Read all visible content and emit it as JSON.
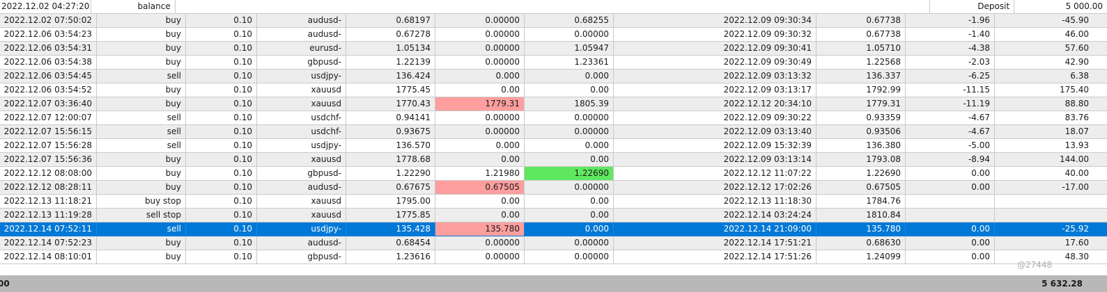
{
  "balance_row": {
    "time": "2022.12.02 04:27:20",
    "type": "balance",
    "comment": "Deposit",
    "profit": "5 000.00"
  },
  "rows": [
    [
      "2022.12.02 07:50:02",
      "buy",
      "0.10",
      "audusd-",
      "0.68197",
      "0.00000",
      "0.68255",
      "2022.12.09 09:30:34",
      "0.67738",
      "-1.96",
      "-45.90"
    ],
    [
      "2022.12.06 03:54:23",
      "buy",
      "0.10",
      "audusd-",
      "0.67278",
      "0.00000",
      "0.00000",
      "2022.12.09 09:30:32",
      "0.67738",
      "-1.40",
      "46.00"
    ],
    [
      "2022.12.06 03:54:31",
      "buy",
      "0.10",
      "eurusd-",
      "1.05134",
      "0.00000",
      "1.05947",
      "2022.12.09 09:30:41",
      "1.05710",
      "-4.38",
      "57.60"
    ],
    [
      "2022.12.06 03:54:38",
      "buy",
      "0.10",
      "gbpusd-",
      "1.22139",
      "0.00000",
      "1.23361",
      "2022.12.09 09:30:49",
      "1.22568",
      "-2.03",
      "42.90"
    ],
    [
      "2022.12.06 03:54:45",
      "sell",
      "0.10",
      "usdjpy-",
      "136.424",
      "0.000",
      "0.000",
      "2022.12.09 03:13:32",
      "136.337",
      "-6.25",
      "6.38"
    ],
    [
      "2022.12.06 03:54:52",
      "buy",
      "0.10",
      "xauusd",
      "1775.45",
      "0.00",
      "0.00",
      "2022.12.09 03:13:17",
      "1792.99",
      "-11.15",
      "175.40"
    ],
    [
      "2022.12.07 03:36:40",
      "buy",
      "0.10",
      "xauusd",
      "1770.43",
      "1779.31",
      "1805.39",
      "2022.12.12 20:34:10",
      "1779.31",
      "-11.19",
      "88.80"
    ],
    [
      "2022.12.07 12:00:07",
      "sell",
      "0.10",
      "usdchf-",
      "0.94141",
      "0.00000",
      "0.00000",
      "2022.12.09 09:30:22",
      "0.93359",
      "-4.67",
      "83.76"
    ],
    [
      "2022.12.07 15:56:15",
      "sell",
      "0.10",
      "usdchf-",
      "0.93675",
      "0.00000",
      "0.00000",
      "2022.12.09 03:13:40",
      "0.93506",
      "-4.67",
      "18.07"
    ],
    [
      "2022.12.07 15:56:28",
      "sell",
      "0.10",
      "usdjpy-",
      "136.570",
      "0.000",
      "0.000",
      "2022.12.09 15:32:39",
      "136.380",
      "-5.00",
      "13.93"
    ],
    [
      "2022.12.07 15:56:36",
      "buy",
      "0.10",
      "xauusd",
      "1778.68",
      "0.00",
      "0.00",
      "2022.12.09 03:13:14",
      "1793.08",
      "-8.94",
      "144.00"
    ],
    [
      "2022.12.12 08:08:00",
      "buy",
      "0.10",
      "gbpusd-",
      "1.22290",
      "1.21980",
      "1.22690",
      "2022.12.12 11:07:22",
      "1.22690",
      "0.00",
      "40.00"
    ],
    [
      "2022.12.12 08:28:11",
      "buy",
      "0.10",
      "audusd-",
      "0.67675",
      "0.67505",
      "0.00000",
      "2022.12.12 17:02:26",
      "0.67505",
      "0.00",
      "-17.00"
    ],
    [
      "2022.12.13 11:18:21",
      "buy stop",
      "0.10",
      "xauusd",
      "1795.00",
      "0.00",
      "0.00",
      "2022.12.13 11:18:30",
      "1784.76",
      "",
      ""
    ],
    [
      "2022.12.13 11:19:28",
      "sell stop",
      "0.10",
      "xauusd",
      "1775.85",
      "0.00",
      "0.00",
      "2022.12.14 03:24:24",
      "1810.84",
      "",
      ""
    ],
    [
      "2022.12.14 07:52:11",
      "sell",
      "0.10",
      "usdjpy-",
      "135.428",
      "135.780",
      "0.000",
      "2022.12.14 21:09:00",
      "135.780",
      "0.00",
      "-25.92"
    ],
    [
      "2022.12.14 07:52:23",
      "buy",
      "0.10",
      "audusd-",
      "0.68454",
      "0.00000",
      "0.00000",
      "2022.12.14 17:51:21",
      "0.68630",
      "0.00",
      "17.60"
    ],
    [
      "2022.12.14 08:10:01",
      "buy",
      "0.10",
      "gbpusd-",
      "1.23616",
      "0.00000",
      "0.00000",
      "2022.12.14 17:51:26",
      "1.24099",
      "0.00",
      "48.30"
    ]
  ],
  "highlights": {
    "6": {
      "5": "red"
    },
    "11": {
      "6": "green"
    },
    "12": {
      "5": "red"
    },
    "15": {
      "5": "red"
    }
  },
  "selected_row": 15,
  "footer": {
    "left": "00",
    "right": "5 632.28"
  },
  "watermark": "@27448",
  "colors": {
    "selected": "#0078d7",
    "sl_hit": "#ff9e9e",
    "tp_hit": "#5fe85f",
    "footer_bg": "#b8b8b8"
  }
}
